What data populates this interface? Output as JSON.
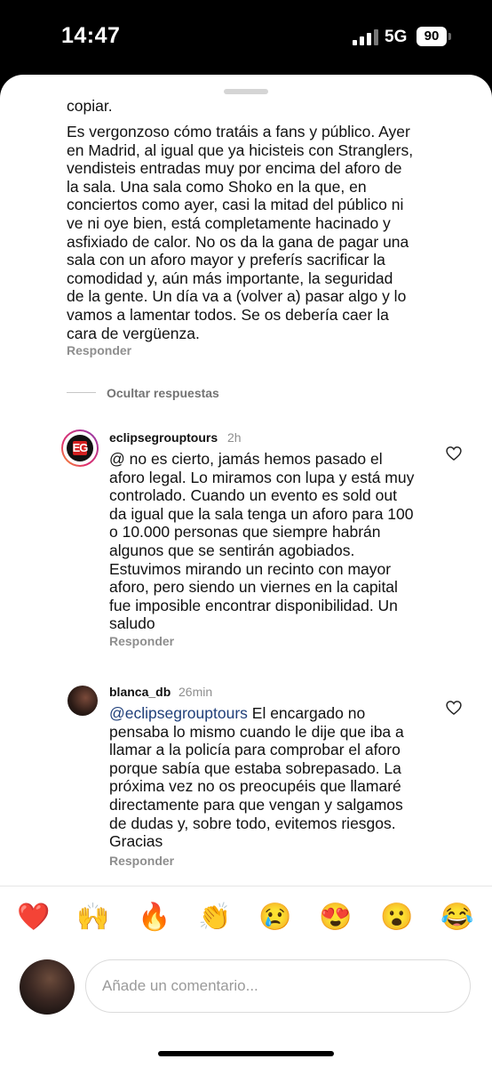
{
  "status_bar": {
    "time": "14:47",
    "network": "5G",
    "battery": "90"
  },
  "original_comment": {
    "partial_top_text": "copiar.",
    "text": "Es vergonzoso cómo tratáis a fans y público. Ayer\nen Madrid, al igual que ya hicisteis con Stranglers,\nvendisteis entradas muy por encima del aforo de\nla sala. Una sala como Shoko en la que, en\nconciertos como ayer, casi la mitad del público ni\nve ni oye bien, está completamente hacinado y\nasfixiado de calor. No os da la gana de pagar una\nsala con un aforo mayor y preferís sacrificar la\ncomodidad y, aún más importante, la seguridad\nde la gente. Un día va a (volver a) pasar algo y lo\nvamos a lamentar todos. Se os debería caer la\ncara de vergüenza.",
    "reply_label": "Responder"
  },
  "hide_replies_label": "Ocultar respuestas",
  "replies": [
    {
      "username": "eclipsegrouptours",
      "time": "2h",
      "avatar_text": "EG",
      "text": "@ no es cierto, jamás hemos pasado el\naforo legal. Lo miramos con lupa y está muy\ncontrolado. Cuando un evento es sold out\nda igual que la sala tenga un aforo para 100\no 10.000 personas que siempre habrán\nalgunos que se sentirán agobiados.\nEstuvimos mirando un recinto con mayor\naforo, pero siendo un viernes en la capital\nfue imposible encontrar disponibilidad. Un\nsaludo",
      "reply_label": "Responder"
    },
    {
      "username": "blanca_db",
      "time": "26min",
      "mention": "@eclipsegrouptours",
      "text": " El encargado no\npensaba lo mismo cuando le dije que iba a\nllamar a la policía para comprobar el aforo\nporque sabía que estaba sobrepasado. La\npróxima vez no os preocupéis que llamaré\ndirectamente para que vengan y salgamos\nde dudas y, sobre todo, evitemos riesgos.\nGracias",
      "reply_label": "Responder"
    }
  ],
  "reactions": [
    "❤️",
    "🙌",
    "🔥",
    "👏",
    "😢",
    "😍",
    "😮",
    "😂"
  ],
  "comment_input": {
    "placeholder": "Añade un comentario..."
  },
  "colors": {
    "mention": "#1f3f7a",
    "secondary_text": "#8e8e8e"
  }
}
